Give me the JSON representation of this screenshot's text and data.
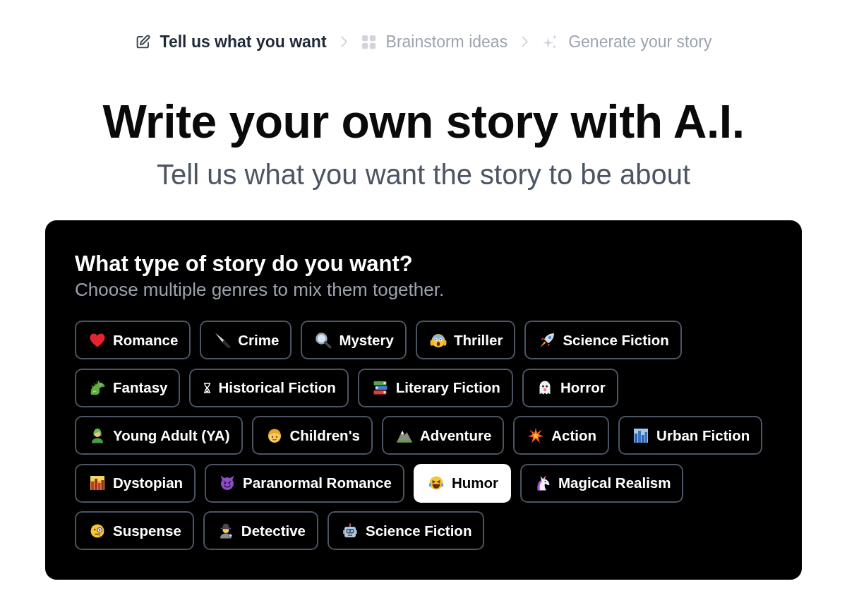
{
  "steps": [
    {
      "label": "Tell us what you want",
      "selected": true
    },
    {
      "label": "Brainstorm ideas",
      "selected": false
    },
    {
      "label": "Generate your story",
      "selected": false
    }
  ],
  "hero": {
    "title": "Write your own story with A.I.",
    "subtitle": "Tell us what you want the story to be about"
  },
  "genre_picker": {
    "heading": "What type of story do you want?",
    "subheading": "Choose multiple genres to mix them together.",
    "genre_rows": [
      [
        {
          "label": "Romance",
          "selected": false
        },
        {
          "label": "Crime",
          "selected": false
        },
        {
          "label": "Mystery",
          "selected": false
        },
        {
          "label": "Thriller",
          "selected": false
        },
        {
          "label": "Science Fiction",
          "selected": false
        }
      ],
      [
        {
          "label": "Fantasy",
          "selected": false
        },
        {
          "label": "Historical Fiction",
          "selected": false
        },
        {
          "label": "Literary Fiction",
          "selected": false
        },
        {
          "label": "Horror",
          "selected": false
        }
      ],
      [
        {
          "label": "Young Adult (YA)",
          "selected": false
        },
        {
          "label": "Children's",
          "selected": false
        },
        {
          "label": "Adventure",
          "selected": false
        },
        {
          "label": "Action",
          "selected": false
        },
        {
          "label": "Urban Fiction",
          "selected": false
        }
      ],
      [
        {
          "label": "Dystopian",
          "selected": false
        },
        {
          "label": "Paranormal Romance",
          "selected": false
        },
        {
          "label": "Humor",
          "selected": true
        },
        {
          "label": "Magical Realism",
          "selected": false
        }
      ],
      [
        {
          "label": "Suspense",
          "selected": false
        },
        {
          "label": "Detective",
          "selected": false
        },
        {
          "label": "Science Fiction",
          "selected": false
        }
      ]
    ]
  }
}
